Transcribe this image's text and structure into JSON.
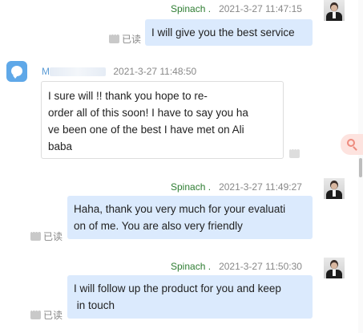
{
  "messages": [
    {
      "sender": "Spinach .",
      "time": "2021-3-27 11:47:15",
      "text": "I will give you the best service",
      "read_label": "已读"
    },
    {
      "sender": "M",
      "time": "2021-3-27 11:48:50",
      "text_lines": [
        "I sure will !! thank you hope to re-",
        "order all of this soon! I have to say you ha",
        "ve been one of the best I have met on Ali",
        "baba"
      ]
    },
    {
      "sender": "Spinach .",
      "time": "2021-3-27 11:49:27",
      "text_lines": [
        "Haha, thank you very much for your evaluati",
        "on of me. You are also very friendly"
      ],
      "read_label": "已读"
    },
    {
      "sender": "Spinach .",
      "time": "2021-3-27 11:50:30",
      "text_lines": [
        "I will follow up the product for you and keep",
        " in touch"
      ],
      "read_label": "已读"
    }
  ],
  "icons": {
    "avatar_self": "businessman-avatar-icon",
    "avatar_other": "chat-bubble-avatar-icon",
    "side_search": "search-icon",
    "read_marker": "more-dots-icon"
  }
}
